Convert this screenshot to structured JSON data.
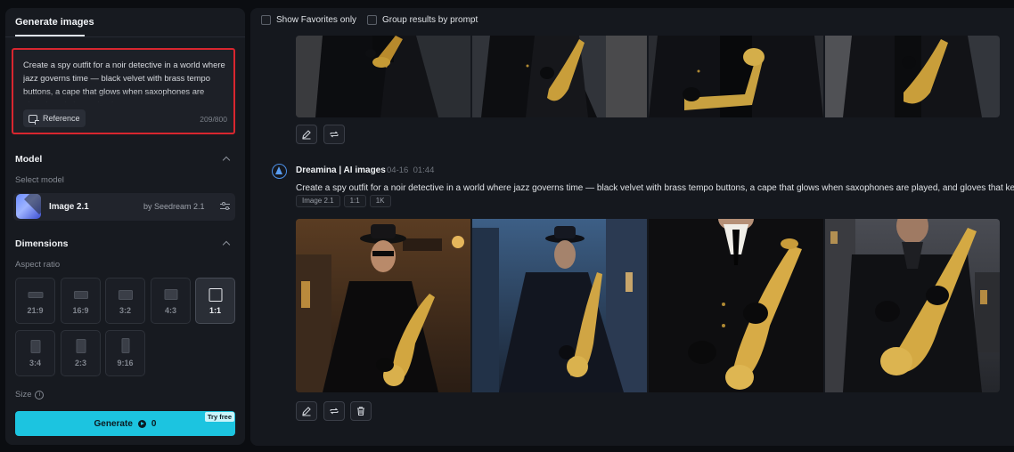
{
  "left_panel": {
    "tab_label": "Generate images",
    "prompt": {
      "text": "Create a spy outfit for a noir detective in a world where jazz governs time — black velvet with brass tempo buttons, a cape that glows when saxophones are played, and gloves that keep",
      "reference_label": "Reference",
      "char_count": "209/800"
    },
    "model_section": {
      "title": "Model",
      "select_label": "Select model",
      "model_name": "Image 2.1",
      "model_by": "by Seedream 2.1"
    },
    "dimensions_section": {
      "title": "Dimensions",
      "aspect_label": "Aspect ratio",
      "aspect_ratios": [
        "21:9",
        "16:9",
        "3:2",
        "4:3",
        "1:1",
        "3:4",
        "2:3",
        "9:16"
      ],
      "selected_aspect": "1:1"
    },
    "size_label": "Size",
    "generate_button": {
      "label": "Generate",
      "cost": "0",
      "badge": "Try free"
    }
  },
  "right_panel": {
    "filters": {
      "favorites_label": "Show Favorites only",
      "group_label": "Group results by prompt"
    },
    "generation": {
      "title": "Dreamina | AI images",
      "date": "04-16",
      "time": "01:44",
      "prompt": "Create a spy outfit for a noir detective in a world where jazz governs time — black velvet with brass tempo buttons, a cape that glows when saxophones are played, and gloves that keep",
      "tags": [
        "Image 2.1",
        "1:1",
        "1K"
      ]
    }
  },
  "colors": {
    "accent": "#1cc4e0",
    "highlight_border": "#d8262f",
    "panel_bg": "#171a20"
  }
}
